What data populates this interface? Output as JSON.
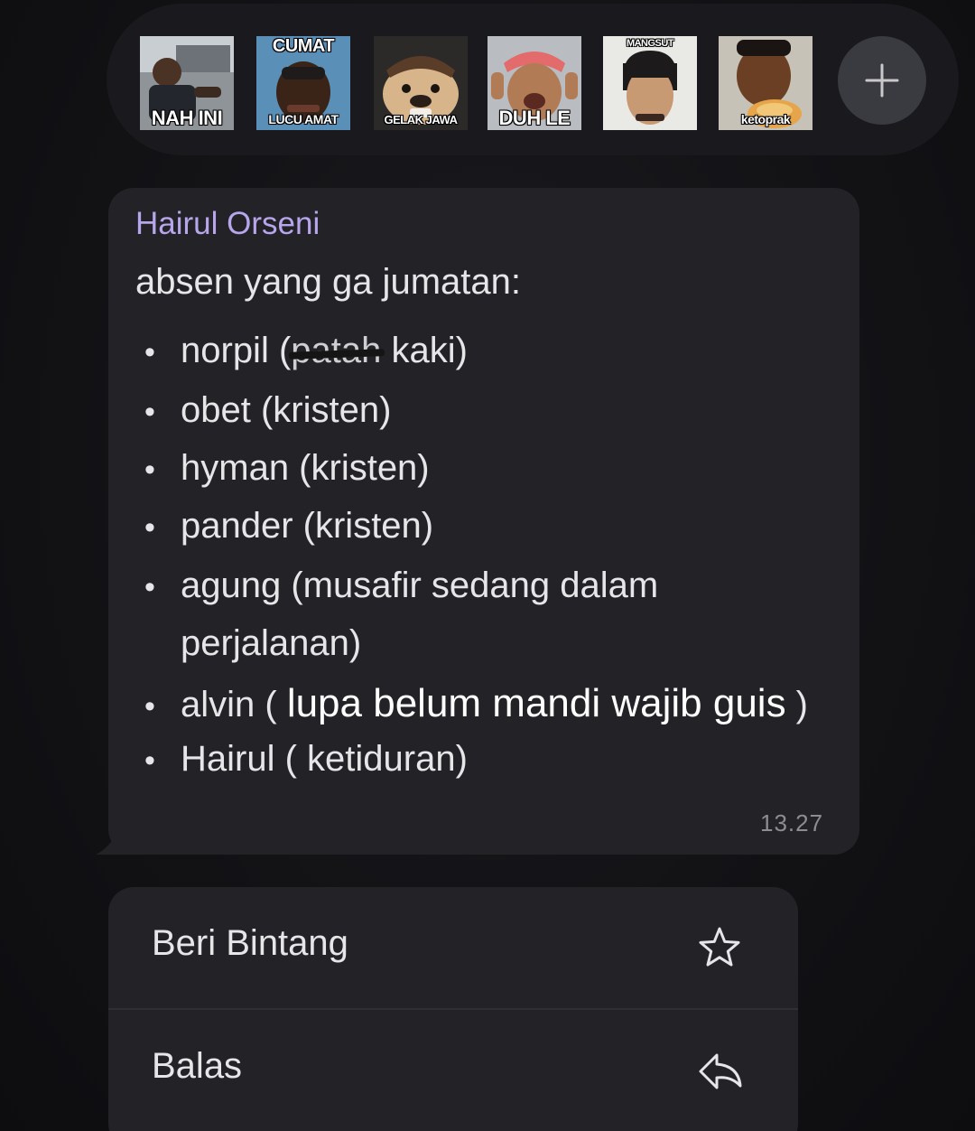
{
  "reaction_bar": {
    "stickers": [
      {
        "name": "sticker-nah-ini",
        "caption_bottom": "NAH INI",
        "caption_top": ""
      },
      {
        "name": "sticker-cumat",
        "caption_top": "CUMAT",
        "caption_bottom": "LUCU AMAT"
      },
      {
        "name": "sticker-gelak-jawa",
        "caption_top": "",
        "caption_bottom": "GELAK JAWA"
      },
      {
        "name": "sticker-duh-le",
        "caption_top": "",
        "caption_bottom": "DUH LE"
      },
      {
        "name": "sticker-mangsut",
        "caption_top": "MANGSUT",
        "caption_bottom": ""
      },
      {
        "name": "sticker-ketoprak",
        "caption_top": "",
        "caption_bottom": "ketoprak"
      }
    ],
    "add_icon": "plus-icon"
  },
  "message": {
    "sender": "Hairul Orseni",
    "intro": "absen yang ga jumatan:",
    "items": [
      {
        "prefix": "norpil (",
        "struck": "patah",
        "suffix": " kaki)"
      },
      {
        "text": "obet (kristen)"
      },
      {
        "text": "hyman (kristen)"
      },
      {
        "text": "pander (kristen)"
      },
      {
        "text": "agung (musafir sedang dalam",
        "continuation": "perjalanan)"
      },
      {
        "prefix": "alvin ( ",
        "overlay": "lupa belum mandi wajib guis",
        "suffix": " )"
      },
      {
        "text": "Hairul ( ketiduran)"
      }
    ],
    "bullet": "•",
    "time": "13.27"
  },
  "context_menu": {
    "items": [
      {
        "label": "Beri Bintang",
        "icon": "star-outline-icon"
      },
      {
        "label": "Balas",
        "icon": "reply-icon"
      }
    ]
  },
  "colors": {
    "background": "#121215",
    "bubble": "#232327",
    "sender_name": "#b8a6ec",
    "text": "#e6e6e8",
    "timestamp": "#8c8c92"
  }
}
